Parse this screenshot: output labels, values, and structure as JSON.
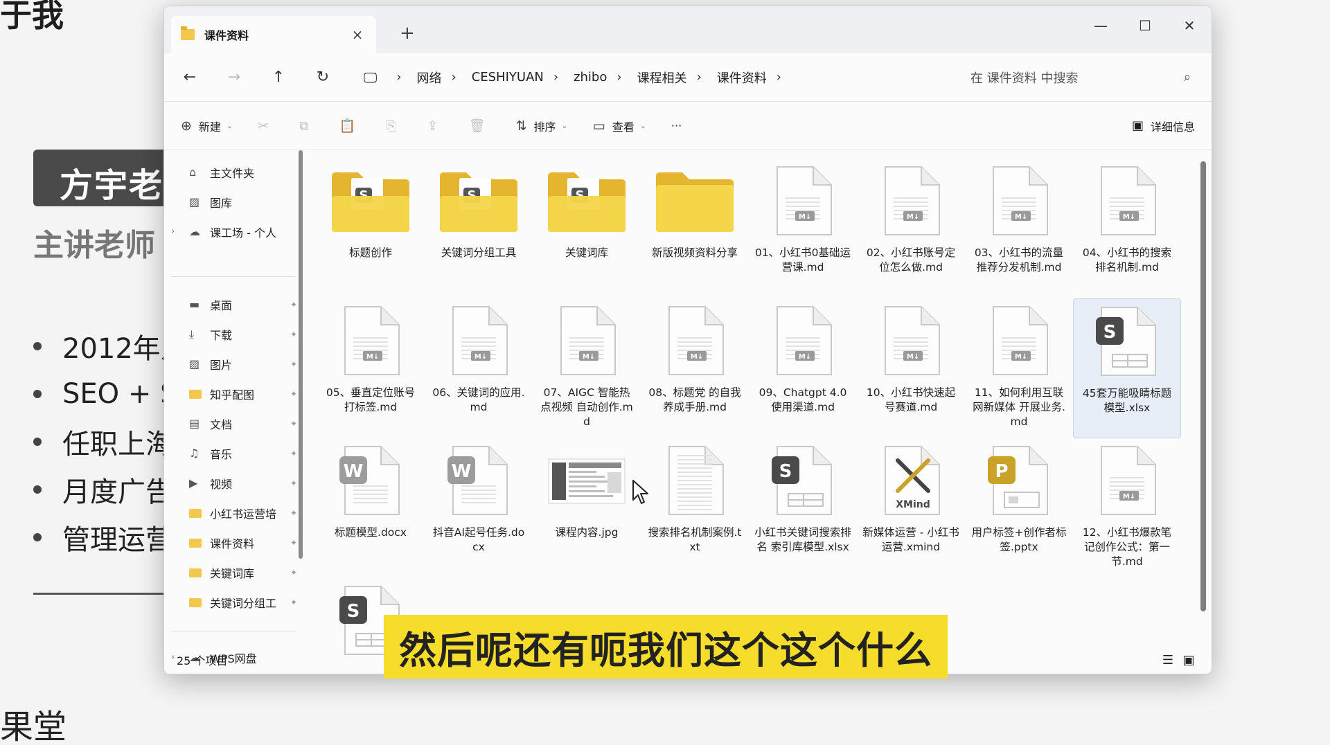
{
  "slide": {
    "top_fragment": "于我",
    "badge": "方宇老",
    "role": "主讲老师",
    "bullets": [
      "2012年从",
      "SEO + S",
      "任职上海",
      "月度广告",
      "管理运营"
    ],
    "footer": "果堂"
  },
  "window": {
    "tab_title": "课件资料",
    "tab_close": "×",
    "new_tab": "+",
    "controls": {
      "minimize": "—",
      "maximize": "☐",
      "close": "✕"
    }
  },
  "address": {
    "back": "←",
    "forward": "→",
    "up": "↑",
    "refresh": "↻",
    "pc_icon": "🖵",
    "crumbs": [
      "网络",
      "CESHIYUAN",
      "zhibo",
      "课程相关",
      "课件资料"
    ],
    "sep": "›",
    "search_placeholder": "在 课件资料 中搜索",
    "search_icon": "⌕"
  },
  "toolbar": {
    "new_label": "新建",
    "sort_label": "排序",
    "view_label": "查看",
    "more": "···",
    "details_label": "详细信息",
    "icons": {
      "new": "⊕",
      "cut": "✂",
      "copy": "⧉",
      "paste": "📋",
      "rename": "⎘",
      "share": "⇪",
      "delete": "🗑",
      "sort": "⇅",
      "view": "▭",
      "details": "▣"
    },
    "caret": "⌄"
  },
  "nav": {
    "items": [
      {
        "label": "主文件夹",
        "icon": "⌂",
        "chev": "",
        "pin": ""
      },
      {
        "label": "图库",
        "icon": "▨",
        "chev": "",
        "pin": ""
      },
      {
        "label": "课工场 - 个人",
        "icon": "☁",
        "chev": "›",
        "pin": ""
      }
    ],
    "pinned": [
      {
        "label": "桌面",
        "icon": "▬",
        "pin": "✦"
      },
      {
        "label": "下载",
        "icon": "⤓",
        "pin": "✦"
      },
      {
        "label": "图片",
        "icon": "▨",
        "pin": "✦"
      },
      {
        "label": "知乎配图",
        "icon": "folder",
        "pin": "✦"
      },
      {
        "label": "文档",
        "icon": "▤",
        "pin": "✦"
      },
      {
        "label": "音乐",
        "icon": "♫",
        "pin": "✦"
      },
      {
        "label": "视频",
        "icon": "▶",
        "pin": "✦"
      },
      {
        "label": "小红书运营培",
        "icon": "folder",
        "pin": "✦"
      },
      {
        "label": "课件资料",
        "icon": "folder",
        "pin": "✦"
      },
      {
        "label": "关键词库",
        "icon": "folder",
        "pin": "✦"
      },
      {
        "label": "关键词分组工",
        "icon": "folder",
        "pin": "✦"
      }
    ],
    "wps": {
      "label": "WPS网盘",
      "icon": "☁",
      "chev": "›"
    }
  },
  "files": [
    {
      "name": "标题创作",
      "type": "folder-s"
    },
    {
      "name": "关键词分组工具",
      "type": "folder-s"
    },
    {
      "name": "关键词库",
      "type": "folder-s"
    },
    {
      "name": "新版视频资料分享",
      "type": "folder"
    },
    {
      "name": "01、小红书0基础运营课.md",
      "type": "md"
    },
    {
      "name": "02、小红书账号定位怎么做.md",
      "type": "md"
    },
    {
      "name": "03、小红书的流量推荐分发机制.md",
      "type": "md"
    },
    {
      "name": "04、小红书的搜索排名机制.md",
      "type": "md"
    },
    {
      "name": "05、垂直定位账号打标签.md",
      "type": "md"
    },
    {
      "name": "06、关键词的应用.md",
      "type": "md"
    },
    {
      "name": "07、AIGC 智能热点视频 自动创作.md",
      "type": "md"
    },
    {
      "name": "08、标题党 的自我养成手册.md",
      "type": "md"
    },
    {
      "name": "09、Chatgpt 4.0使用渠道.md",
      "type": "md"
    },
    {
      "name": "10、小红书快速起号赛道.md",
      "type": "md"
    },
    {
      "name": "11、如何利用互联网新媒体 开展业务.md",
      "type": "md"
    },
    {
      "name": "45套万能吸睛标题模型.xlsx",
      "type": "xlsx",
      "selected": true
    },
    {
      "name": "标题模型.docx",
      "type": "docx"
    },
    {
      "name": "抖音AI起号任务.docx",
      "type": "docx"
    },
    {
      "name": "课程内容.jpg",
      "type": "jpg"
    },
    {
      "name": "搜索排名机制案例.txt",
      "type": "txt"
    },
    {
      "name": "小红书关键词搜索排名 索引库模型.xlsx",
      "type": "xlsx"
    },
    {
      "name": "新媒体运营 - 小红书运营.xmind",
      "type": "xmind"
    },
    {
      "name": "用户标签+创作者标签.pptx",
      "type": "pptx"
    },
    {
      "name": "12、小红书爆款笔记创作公式：第一节.md",
      "type": "md"
    },
    {
      "name": "",
      "type": "xlsx"
    }
  ],
  "status": {
    "count": "25 个项目",
    "list_view": "☰",
    "tile_view": "▣"
  },
  "subtitle": "然后呢还有呃我们这个这个什么",
  "colors": {
    "folder": "#f2c94c",
    "subtitle_bg": "#f6dd2c",
    "wps_s": "#4a4a4a",
    "pptx": "#c9a227"
  }
}
